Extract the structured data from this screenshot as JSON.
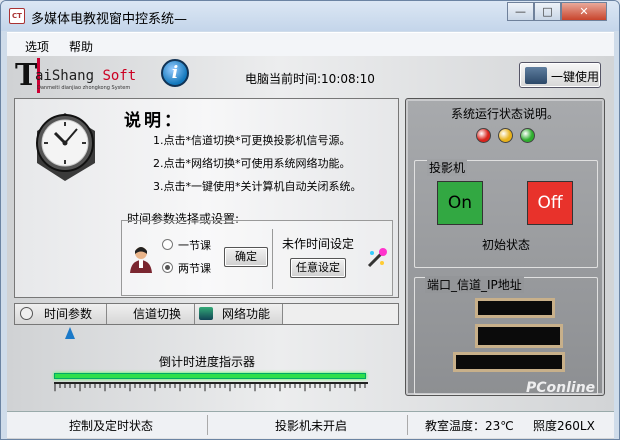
{
  "window": {
    "title": "多媒体电教视窗中控系统—",
    "app_icon": "app-icon",
    "controls": [
      "—",
      "□",
      "✕"
    ]
  },
  "menu": {
    "items": [
      "选项",
      "帮助"
    ]
  },
  "header": {
    "logo_letter": "T",
    "logo_brand_a": "aiShang ",
    "logo_brand_b": "Soft",
    "logo_sub": "Danmeiti dianjiao zhongkong System",
    "clock_label": "电脑当前时间:",
    "clock_time": "10:08:10",
    "one_key_label": "一键使用"
  },
  "explain": {
    "title": "说明：",
    "lines": [
      "1.点击*信道切换*可更换投影机信号源。",
      "2.点击*网络切换*可使用系统网络功能。",
      "3.点击*一键使用*关计算机自动关闭系统。"
    ]
  },
  "params": {
    "label": "时间参数选择或设置:",
    "option1": "一节课",
    "option2": "两节课",
    "selected": "两节课",
    "confirm": "确定",
    "untimed_label": "未作时间设定",
    "any_set": "任意设定"
  },
  "tabs": [
    {
      "label": "时间参数"
    },
    {
      "label": "信道切换"
    },
    {
      "label": "网络功能"
    }
  ],
  "countdown": {
    "label": "倒计时进度指示器",
    "progress": 1.0
  },
  "status_panel": {
    "title": "系统运行状态说明。",
    "lights": [
      "#d9231c",
      "#e8b21b",
      "#2fae2f"
    ],
    "projector_label": "投影机",
    "on_label": "On",
    "off_label": "Off",
    "on_color": "#32a842",
    "off_color": "#e8322b",
    "init_state": "初始状态",
    "port_label": "端口_信道_IP地址"
  },
  "statusbar": {
    "control": "控制及定时状态",
    "projector": "投影机未开启",
    "temp": "教室温度：23℃",
    "light": "照度260LX"
  },
  "watermark": "PConline"
}
